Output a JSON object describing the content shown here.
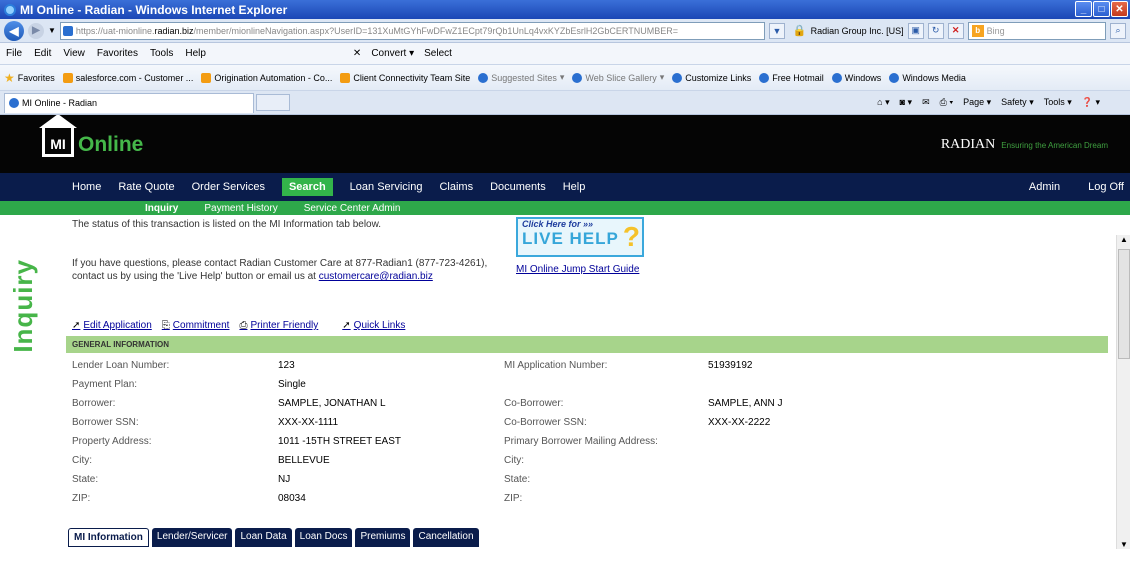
{
  "window": {
    "title": "MI Online - Radian - Windows Internet Explorer"
  },
  "address": {
    "url_prefix": "https://uat-mionline.",
    "url_host": "radian.biz",
    "url_path": "/member/mionlineNavigation.aspx?UserID=131XuMtGYhFwDFwZ1ECpt79rQb1UnLq4vxKYZbEsrlH2GbCERTNUMBER=",
    "cert": "Radian Group Inc. [US]",
    "search_placeholder": "Bing"
  },
  "menubar": {
    "items": [
      "File",
      "Edit",
      "View",
      "Favorites",
      "Tools",
      "Help"
    ],
    "convert": "Convert",
    "select": "Select"
  },
  "favorites": {
    "label": "Favorites",
    "items": [
      "salesforce.com - Customer ...",
      "Origination Automation - Co...",
      "Client Connectivity Team Site",
      "Suggested Sites",
      "Web Slice Gallery",
      "Customize Links",
      "Free Hotmail",
      "Windows",
      "Windows Media"
    ]
  },
  "tab": {
    "title": "MI Online - Radian"
  },
  "cmdbar": {
    "page": "Page",
    "safety": "Safety",
    "tools": "Tools"
  },
  "header": {
    "logo_mi": "MI",
    "logo_text": "Online",
    "brand": "RADIAN",
    "tagline": "Ensuring the American Dream"
  },
  "mainnav": {
    "items": [
      "Home",
      "Rate Quote",
      "Order Services",
      "Search",
      "Loan Servicing",
      "Claims",
      "Documents",
      "Help"
    ],
    "admin": "Admin",
    "logoff": "Log Off"
  },
  "subnav": {
    "items": [
      "Inquiry",
      "Payment History",
      "Service Center Admin"
    ]
  },
  "page": {
    "vertical_title": "Inquiry",
    "status_text": "The status of this transaction is listed on the MI Information tab below.",
    "questions_line1": "If you have questions, please contact Radian Customer Care at 877-Radian1 (877-723-4261),",
    "questions_line2": "contact us by using the 'Live Help' button or email us at ",
    "email": "customercare@radian.biz",
    "livehelp_top": "Click Here for »»",
    "livehelp_main": "LIVE HELP",
    "jumpstart": "MI Online Jump Start Guide",
    "actions": [
      "Edit Application",
      "Commitment",
      "Printer Friendly",
      "Quick Links"
    ],
    "section_title": "GENERAL INFORMATION"
  },
  "info": {
    "left": [
      {
        "label": "Lender Loan Number:",
        "value": "123"
      },
      {
        "label": "Payment Plan:",
        "value": "Single"
      },
      {
        "label": "Borrower:",
        "value": "SAMPLE, JONATHAN L"
      },
      {
        "label": "Borrower SSN:",
        "value": "XXX-XX-1111"
      },
      {
        "label": "Property Address:",
        "value": "1011 -15TH STREET EAST"
      },
      {
        "label": "City:",
        "value": "BELLEVUE"
      },
      {
        "label": "State:",
        "value": "NJ"
      },
      {
        "label": "ZIP:",
        "value": "08034"
      }
    ],
    "right": [
      {
        "label": "MI Application Number:",
        "value": "51939192"
      },
      {
        "label": "",
        "value": ""
      },
      {
        "label": "Co-Borrower:",
        "value": "SAMPLE, ANN J"
      },
      {
        "label": "Co-Borrower SSN:",
        "value": "XXX-XX-2222"
      },
      {
        "label": "Primary Borrower Mailing Address:",
        "value": ""
      },
      {
        "label": "City:",
        "value": ""
      },
      {
        "label": "State:",
        "value": ""
      },
      {
        "label": "ZIP:",
        "value": ""
      }
    ]
  },
  "tabs": [
    "MI Information",
    "Lender/Servicer",
    "Loan Data",
    "Loan Docs",
    "Premiums",
    "Cancellation"
  ]
}
